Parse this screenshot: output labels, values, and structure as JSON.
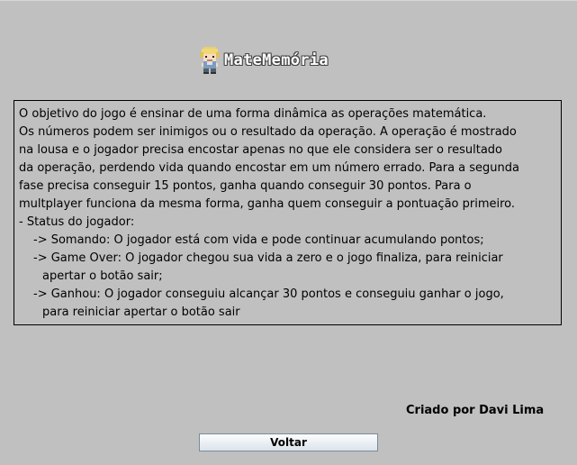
{
  "header": {
    "title": "MateMemória",
    "icon": "pixel-character-icon"
  },
  "description": {
    "lines": [
      "O objetivo do jogo é ensinar de uma forma dinâmica as operações matemática.",
      "Os números podem ser inimigos ou o resultado da operação. A operação é mostrado",
      "na lousa e o jogador precisa encostar apenas no que ele considera ser o resultado",
      "da operação, perdendo vida quando encostar em um número errado. Para a segunda",
      "fase precisa conseguir 15 pontos, ganha quando conseguir 30 pontos. Para o",
      "multplayer funciona da mesma forma, ganha quem conseguir a pontuação primeiro.",
      "- Status do jogador:",
      "-> Somando: O jogador está com vida e pode continuar acumulando pontos;",
      "-> Game Over: O jogador chegou sua vida a zero e o jogo finaliza, para reiniciar",
      "apertar o botão sair;",
      "-> Ganhou: O jogador conseguiu alcançar 30 pontos e conseguiu ganhar o jogo,",
      "para reiniciar apertar o botão sair"
    ]
  },
  "footer": {
    "author": "Criado por Davi Lima",
    "back_label": "Voltar"
  },
  "colors": {
    "background": "#c0c0c0",
    "border": "#000000"
  }
}
